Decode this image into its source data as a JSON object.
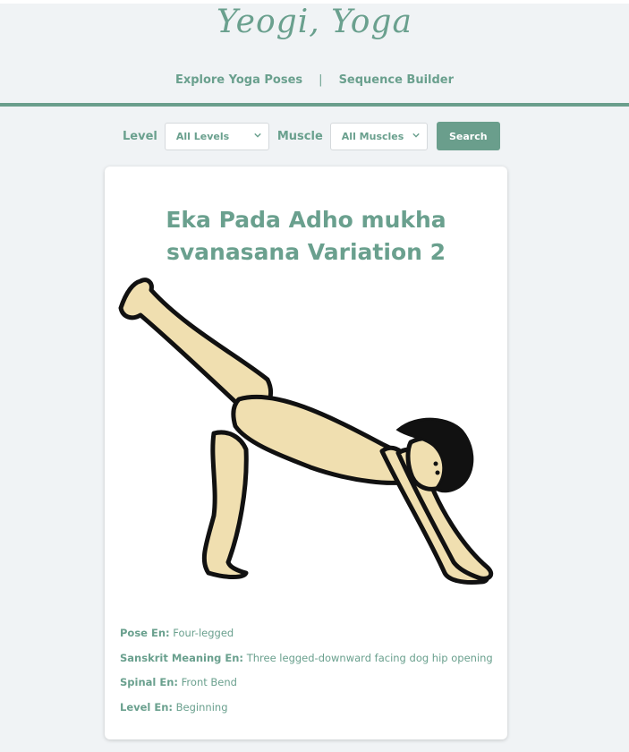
{
  "header": {
    "logo_text": "Yeogi, Yoga",
    "nav": {
      "explore_label": "Explore Yoga Poses",
      "separator": "|",
      "sequence_label": "Sequence Builder"
    }
  },
  "filters": {
    "level_label": "Level",
    "level_value": "All Levels",
    "muscle_label": "Muscle",
    "muscle_value": "All Muscles",
    "search_label": "Search"
  },
  "pose": {
    "title": "Eka Pada Adho mukha svanasana Variation 2",
    "illustration": "downward-dog-leg-raised-figure",
    "details": [
      {
        "key": "Pose En:",
        "value": "Four-legged"
      },
      {
        "key": "Sanskrit Meaning En:",
        "value": "Three legged-downward facing dog hip opening"
      },
      {
        "key": "Spinal En:",
        "value": "Front Bend"
      },
      {
        "key": "Level En:",
        "value": "Beginning"
      }
    ]
  },
  "colors": {
    "accent": "#6a9e8c",
    "page_bg": "#f0f3f5",
    "card_bg": "#ffffff",
    "skin": "#f0dfb0",
    "outline": "#111111"
  }
}
